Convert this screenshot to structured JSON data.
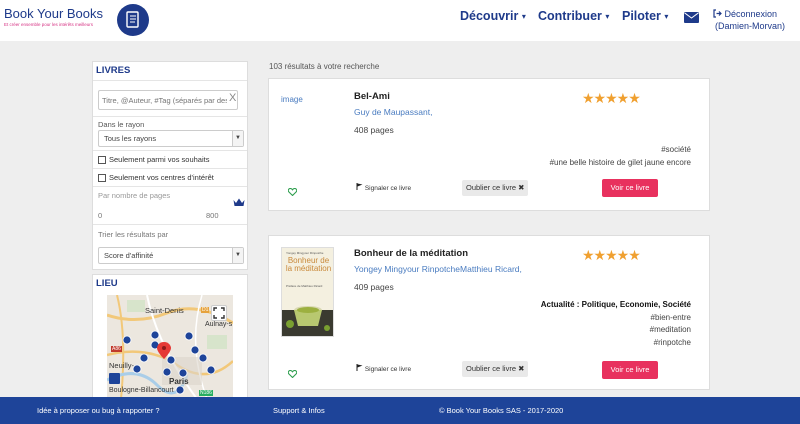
{
  "header": {
    "brand_name": "Book Your Books",
    "brand_tagline": "Et créer ensemble pour les intérêts meilleurs",
    "nav": [
      {
        "label": "Découvrir"
      },
      {
        "label": "Contribuer"
      },
      {
        "label": "Piloter"
      }
    ],
    "logout_label": "Déconnexion",
    "user_name": "(Damien-Morvan)"
  },
  "sidebar": {
    "books_title": "LIVRES",
    "search_placeholder": "Titre, @Auteur, #Tag (séparés par des virgules)",
    "search_clear": "X",
    "shelf_label": "Dans le rayon",
    "shelf_value": "Tous les rayons",
    "wishes_label": "Seulement parmi vos souhaits",
    "interests_label": "Seulement vos centres d'intérêt",
    "pages_label": "Par nombre de pages",
    "pages_min": "0",
    "pages_max": "800",
    "sort_label": "Trier les résultats par",
    "sort_value": "Score d'affinité",
    "place_title": "LIEU",
    "map_labels": {
      "saint_denis": "Saint-Denis",
      "aulnay": "Aulnay-s",
      "neuilly": "Neuilly-",
      "paris": "Paris",
      "boulogne": "Boulogne-Billancourt",
      "a86": "A86",
      "d1": "D1",
      "n186": "N186"
    }
  },
  "results": {
    "count_text": "103 résultats à votre recherche",
    "items": [
      {
        "image_alt": "image",
        "title": "Bel-Ami",
        "authors": "Guy de Maupassant,",
        "pages": "408 pages",
        "rating": 5,
        "tags": [
          "#société",
          "#une belle histoire de gilet jaune encore"
        ],
        "report": "Signaler ce livre",
        "forget": "Oublier ce livre",
        "view": "Voir ce livre"
      },
      {
        "title": "Bonheur de la méditation",
        "authors": "Yongey Mingyour RinpotcheMatthieu Ricard,",
        "pages": "409 pages",
        "rating": 5,
        "category": "Actualité : Politique, Economie, Société",
        "tags": [
          "#bien-entre",
          "#meditation",
          "#rinpotche"
        ],
        "cover_title": "Bonheur de la méditation",
        "cover_authors": "Yongey Mingyour Rinpotche",
        "cover_preface": "Préface de Matthieu Ricard",
        "report": "Signaler ce livre",
        "forget": "Oublier ce livre",
        "view": "Voir ce livre"
      }
    ]
  },
  "footer": {
    "idea": "Idée à proposer ou bug à rapporter ?",
    "support": "Support & Infos",
    "copyright": "© Book Your Books SAS - 2017-2020"
  },
  "colors": {
    "brand": "#1e3a8a",
    "footer": "#1e4499",
    "accent": "#e8315e",
    "star": "#f0a030",
    "link": "#4a7cc0"
  },
  "icons": [
    "book-logo-icon",
    "mail-icon",
    "logout-icon",
    "crown-icon",
    "heart-icon",
    "flag-icon",
    "close-icon",
    "fullscreen-icon",
    "map-marker-icon"
  ]
}
